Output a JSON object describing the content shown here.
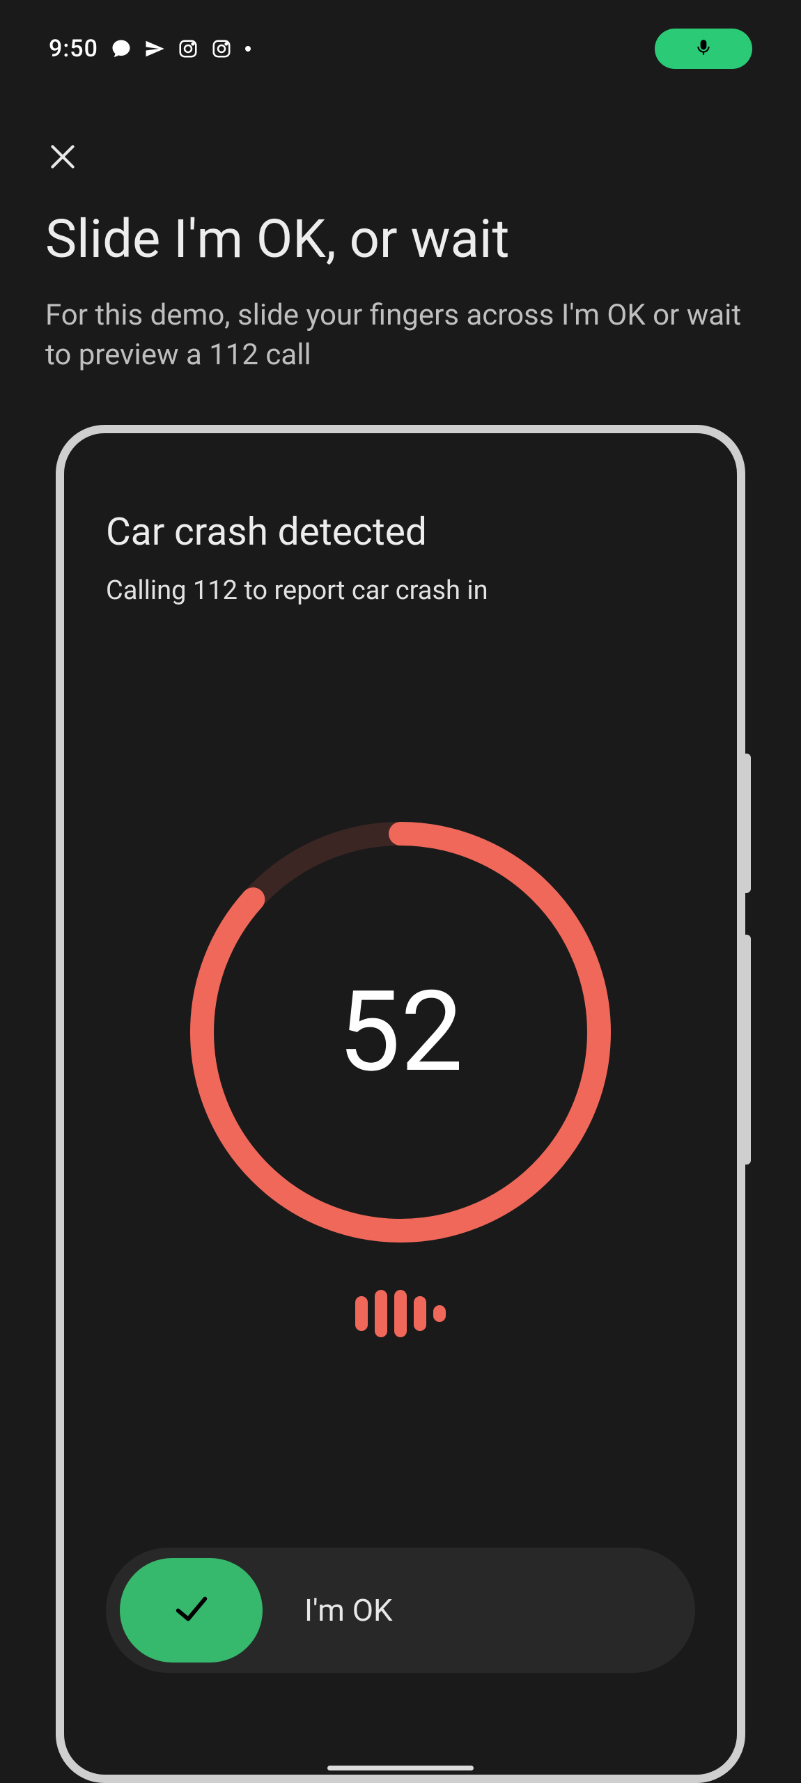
{
  "status": {
    "time": "9:50",
    "icons": [
      "chat-icon",
      "paper-plane-icon",
      "instagram-icon",
      "instagram-icon",
      "dot-icon"
    ],
    "mic_color": "#2bca76"
  },
  "page": {
    "title": "Slide I'm OK, or wait",
    "subtitle": "For this demo, slide your fingers across I'm OK or wait to preview a 112 call"
  },
  "panel": {
    "title": "Car crash detected",
    "subtitle": "Calling 112 to report car crash in"
  },
  "countdown": {
    "value": "52",
    "total": 60,
    "remaining": 52,
    "ring_color": "#f0685a",
    "track_color": "#3b2623"
  },
  "wave": {
    "heights": [
      50,
      68,
      68,
      50,
      24
    ],
    "color": "#f0685a"
  },
  "slider": {
    "label": "I'm OK",
    "thumb_color": "#36b96c",
    "track_color": "#282828"
  }
}
